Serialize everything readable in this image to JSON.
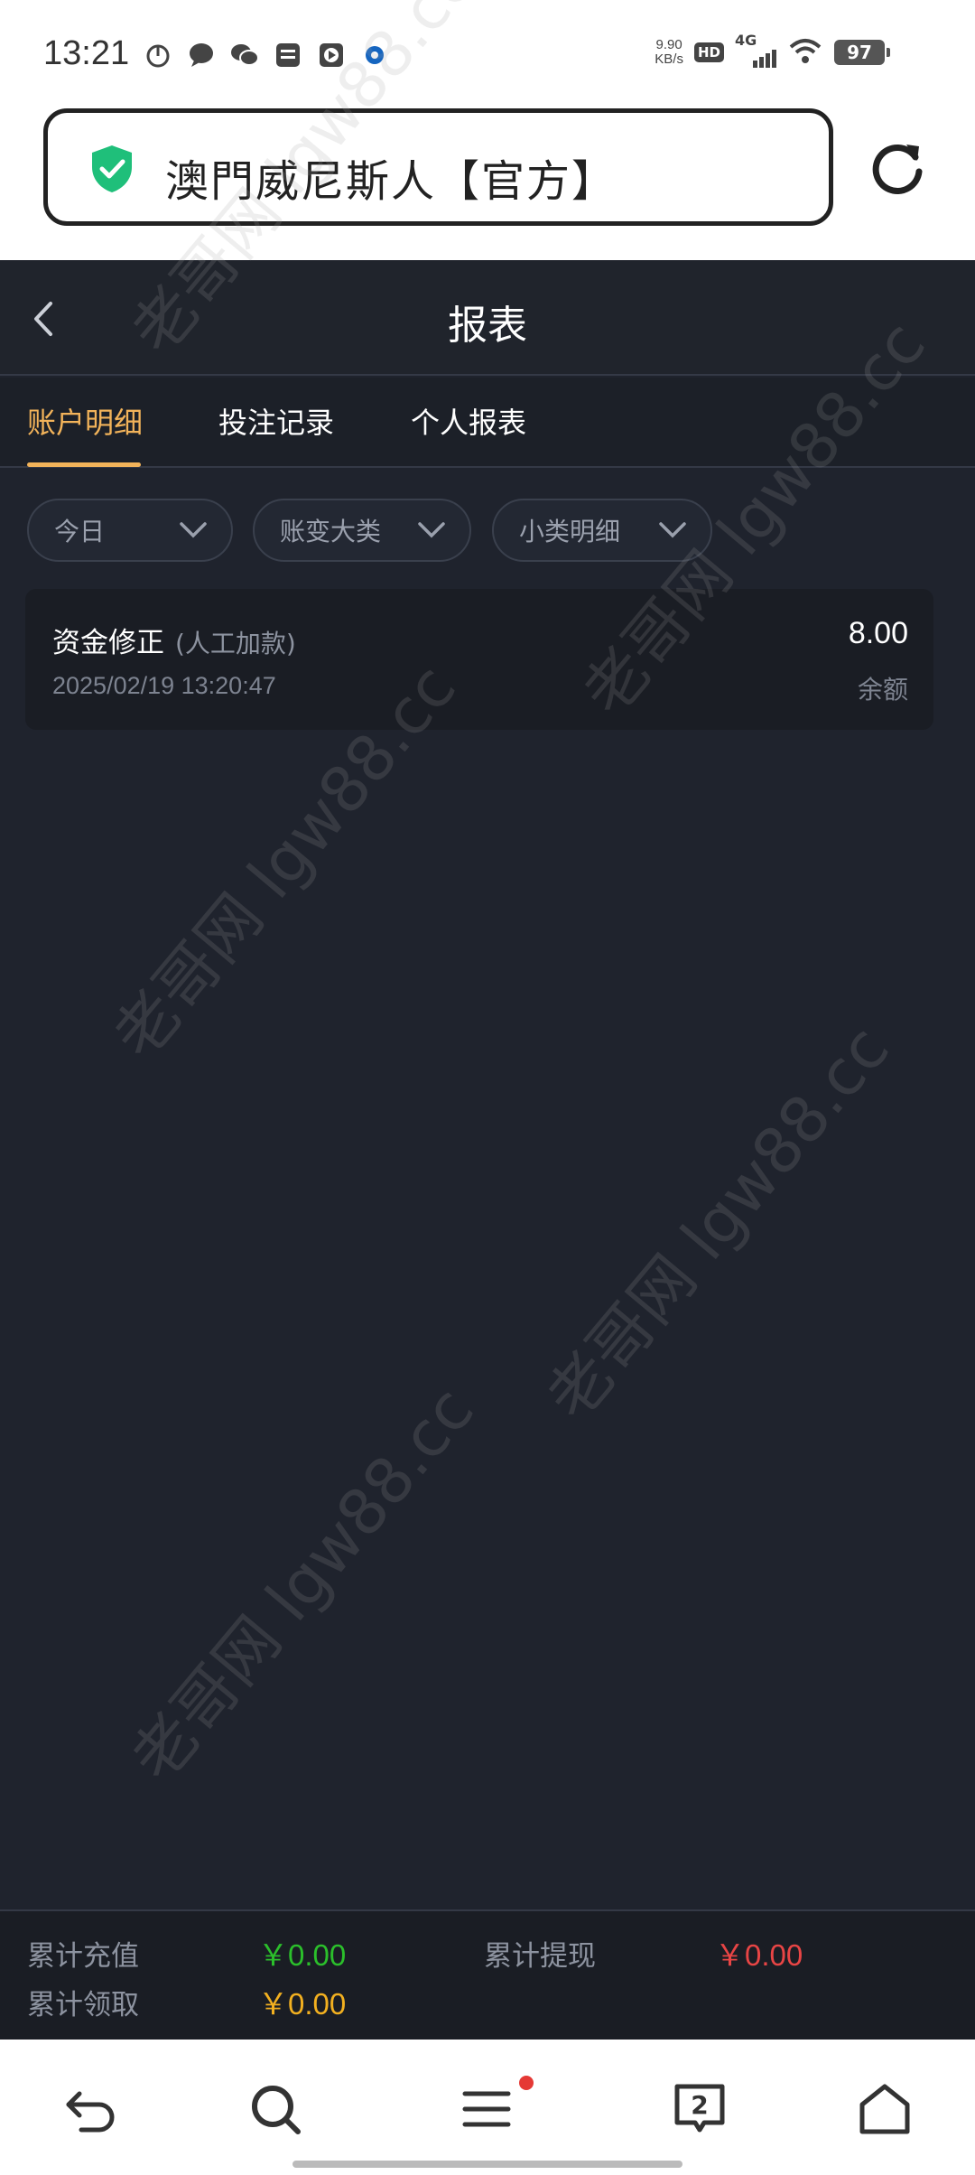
{
  "status_bar": {
    "time": "13:21",
    "net_speed_value": "9.90",
    "net_speed_unit": "KB/s",
    "hd": "HD",
    "network": "4G",
    "battery": "97"
  },
  "url_bar": {
    "title": "澳門威尼斯人【官方】",
    "secure_icon": "shield-check-icon",
    "reload_icon": "reload-icon"
  },
  "header": {
    "title": "报表",
    "back_icon": "chevron-left-icon"
  },
  "tabs": [
    {
      "label": "账户明细",
      "active": true
    },
    {
      "label": "投注记录",
      "active": false
    },
    {
      "label": "个人报表",
      "active": false
    }
  ],
  "filters": [
    {
      "label": "今日"
    },
    {
      "label": "账变大类"
    },
    {
      "label": "小类明细"
    }
  ],
  "records": [
    {
      "title": "资金修正",
      "tag": "(人工加款)",
      "time": "2025/02/19 13:20:47",
      "amount": "8.00",
      "balance_label": "余额"
    }
  ],
  "summary": {
    "recharge_label": "累计充值",
    "recharge_value": "￥0.00",
    "withdraw_label": "累计提现",
    "withdraw_value": "￥0.00",
    "claim_label": "累计领取",
    "claim_value": "￥0.00",
    "colors": {
      "recharge": "#2bbf2b",
      "withdraw": "#e84545",
      "claim": "#f2b020"
    }
  },
  "bottom_nav": {
    "tab_count": "2",
    "icons": [
      "back-arrow-icon",
      "search-icon",
      "menu-icon",
      "tabs-icon",
      "home-icon"
    ]
  },
  "watermark": {
    "text": "老哥网 lgw88.cc"
  }
}
